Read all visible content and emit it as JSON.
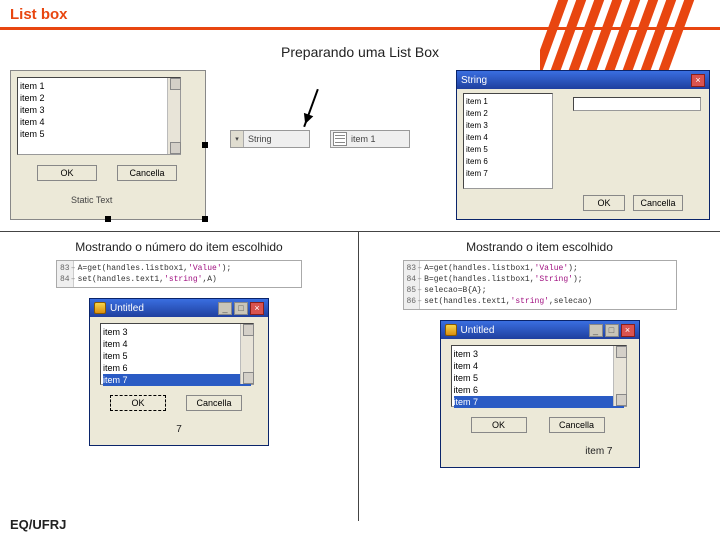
{
  "page": {
    "title": "List box",
    "subtitle": "Preparando uma List Box",
    "footer": "EQ/UFRJ"
  },
  "dialogL": {
    "items": [
      "item 1",
      "item 2",
      "item 3",
      "item 4",
      "item 5"
    ],
    "ok": "OK",
    "cancel": "Cancella",
    "static_label": "Static Text"
  },
  "fields": {
    "a": "String",
    "b": "item 1"
  },
  "winR": {
    "title": "String",
    "items": [
      "item 1",
      "item 2",
      "item 3",
      "item 4",
      "item 5",
      "item 6",
      "item 7"
    ],
    "ok": "OK",
    "cancel": "Cancella"
  },
  "columns": {
    "left_title": "Mostrando o número do item escolhido",
    "right_title": "Mostrando o item escolhido"
  },
  "codeL": {
    "lines": [
      "83",
      "84"
    ],
    "l1a": "A=get(handles.listbox1,",
    "l1b": "'Value'",
    "l1c": ");",
    "l2a": "set(handles.text1,",
    "l2b": "'string'",
    "l2c": ",A)"
  },
  "codeR": {
    "lines": [
      "83",
      "84",
      "85",
      "86"
    ],
    "l1a": "A=get(handles.listbox1,",
    "l1b": "'Value'",
    "l1c": ");",
    "l2a": "B=get(handles.listbox1,",
    "l2b": "'String'",
    "l2c": ");",
    "l3": "selecao=B{A};",
    "l4a": "set(handles.text1,",
    "l4b": "'string'",
    "l4c": ",selecao)"
  },
  "uwindow": {
    "title": "Untitled",
    "items": [
      "item 3",
      "item 4",
      "item 5",
      "item 6",
      "item 7"
    ],
    "ok": "OK",
    "cancel": "Cancella",
    "outL": "7",
    "outR": "item 7"
  }
}
